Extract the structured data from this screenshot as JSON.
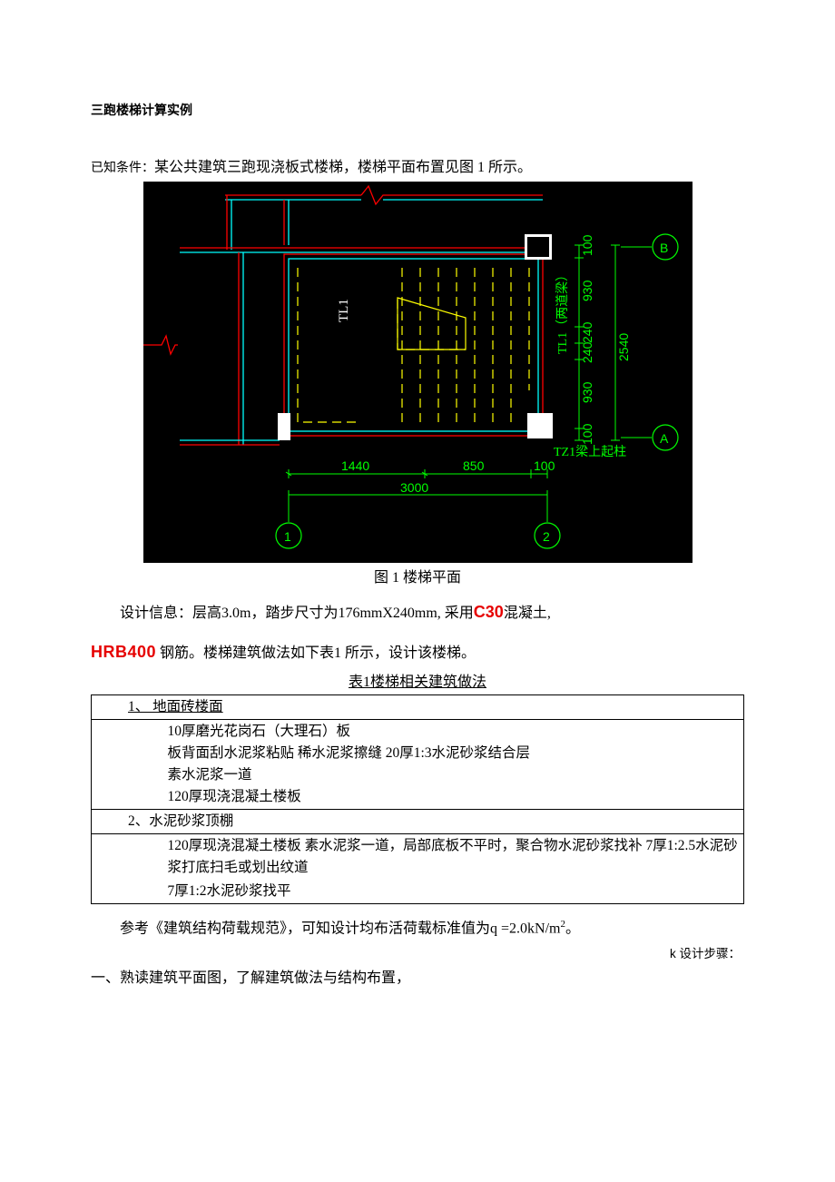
{
  "doc": {
    "title": "三跑楼梯计算实例",
    "condition_label": "已知条件：",
    "condition_text": "某公共建筑三跑现浇板式楼梯，楼梯平面布置见图 1 所示。",
    "fig_caption": "图 1 楼梯平面"
  },
  "diagram": {
    "tl1": "TL1",
    "tl1_note": "TL1（两道梁）",
    "tz1": "TZ1梁上起柱",
    "dims": {
      "d1440": "1440",
      "d850": "850",
      "d100a": "100",
      "d3000": "3000",
      "d100b": "100",
      "d930a": "930",
      "d240a": "240",
      "d240b": "240",
      "d930b": "930",
      "d100c": "100",
      "d2540": "2540"
    },
    "axes": {
      "a": "A",
      "b": "B",
      "n1": "1",
      "n2": "2"
    }
  },
  "design_info": {
    "line1_pre": "设计信息：层高3.0m，踏步尺寸为176mmX240mm, 采用",
    "c30": "C30",
    "line1_post": "混凝土,",
    "hrb": "HRB400",
    "line2_rest": " 钢筋。楼梯建筑做法如下表1 所示，设计该楼梯。"
  },
  "table": {
    "caption": "表1楼梯相关建筑做法",
    "row1_head": "1、                                                                                                                                                地面砖楼面",
    "row1_body": "10厚磨光花岗石（大理石）板\n板背面刮水泥浆粘贴  稀水泥浆擦缝  20厚1:3水泥砂浆结合层\n素水泥浆一道\n120厚现浇混凝土楼板",
    "row2_head": "2、水泥砂浆顶棚",
    "row2_body": "120厚现浇混凝土楼板 素水泥浆一道，局部底板不平时，聚合物水泥砂浆找补 7厚1:2.5水泥砂浆打底扫毛或划出纹道",
    "row2_body2": "7厚1:2水泥砂浆找平"
  },
  "ref": {
    "text_pre": "参考《建筑结构荷载规范》，可知设计均布活荷载标准值为q",
    "sub": "k",
    "eq": " =2.0kN/m",
    "sup": "2",
    "period": "。"
  },
  "steps": {
    "label": "k 设计步骤：",
    "item1": "一、熟读建筑平面图，了解建筑做法与结构布置，"
  }
}
